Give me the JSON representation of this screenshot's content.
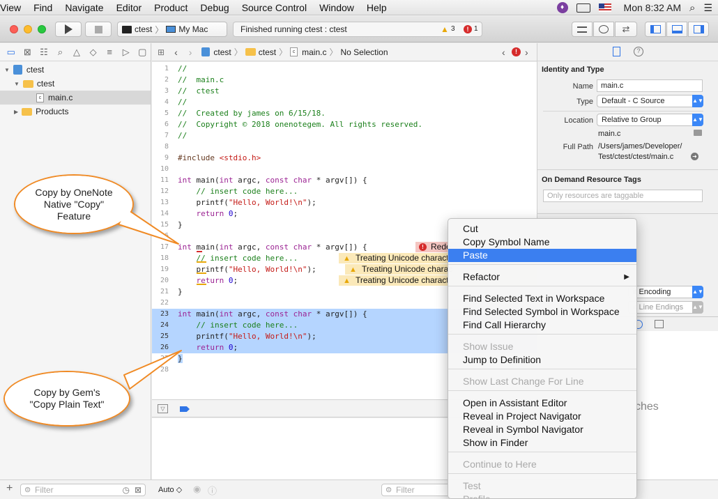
{
  "menubar": {
    "items": [
      "View",
      "Find",
      "Navigate",
      "Editor",
      "Product",
      "Debug",
      "Source Control",
      "Window",
      "Help"
    ],
    "clock": "Mon 8:32 AM"
  },
  "toolbar": {
    "scheme": "ctest",
    "destination": "My Mac",
    "status": "Finished running ctest : ctest",
    "warning_count": "3",
    "error_count": "1"
  },
  "navigator": {
    "items": [
      {
        "label": "ctest",
        "kind": "project"
      },
      {
        "label": "ctest",
        "kind": "folder"
      },
      {
        "label": "main.c",
        "kind": "file"
      },
      {
        "label": "Products",
        "kind": "folder"
      }
    ],
    "filter_placeholder": "Filter"
  },
  "jumpbar": {
    "crumbs": [
      "ctest",
      "ctest",
      "main.c",
      "No Selection"
    ]
  },
  "editor": {
    "lines": [
      {
        "n": "1",
        "t": "//",
        "c": "cm"
      },
      {
        "n": "2",
        "t": "//  main.c",
        "c": "cm"
      },
      {
        "n": "3",
        "t": "//  ctest",
        "c": "cm"
      },
      {
        "n": "4",
        "t": "//",
        "c": "cm"
      },
      {
        "n": "5",
        "t": "//  Created by james on 6/15/18.",
        "c": "cm"
      },
      {
        "n": "6",
        "t": "//  Copyright © 2018 onenotegem. All rights reserved.",
        "c": "cm"
      },
      {
        "n": "7",
        "t": "//",
        "c": "cm"
      },
      {
        "n": "8",
        "t": "",
        "c": ""
      },
      {
        "n": "9",
        "t": "#include <stdio.h>",
        "c": "pp"
      },
      {
        "n": "10",
        "t": "",
        "c": ""
      },
      {
        "n": "11",
        "t": "int main(int argc, const char * argv[]) {",
        "c": "fn"
      },
      {
        "n": "12",
        "t": "    // insert code here...",
        "c": "cm"
      },
      {
        "n": "13",
        "t": "    printf(\"Hello, World!\\n\");",
        "c": "pf"
      },
      {
        "n": "14",
        "t": "    return 0;",
        "c": "rt"
      },
      {
        "n": "15",
        "t": "}",
        "c": ""
      },
      {
        "n": "16",
        "t": "",
        "c": ""
      },
      {
        "n": "17",
        "t": "int main(int argc, const char * argv[]) {",
        "c": "fn"
      },
      {
        "n": "18",
        "t": "    // insert code here...",
        "c": "cm"
      },
      {
        "n": "19",
        "t": "    printf(\"Hello, World!\\n\");",
        "c": "pf"
      },
      {
        "n": "20",
        "t": "    return 0;",
        "c": "rt"
      },
      {
        "n": "21",
        "t": "}",
        "c": ""
      },
      {
        "n": "22",
        "t": "",
        "c": ""
      },
      {
        "n": "23",
        "t": "int main(int argc, const char * argv[]) {",
        "c": "fn"
      },
      {
        "n": "24",
        "t": "    // insert code here...",
        "c": "cm"
      },
      {
        "n": "25",
        "t": "    printf(\"Hello, World!\\n\");",
        "c": "pf"
      },
      {
        "n": "26",
        "t": "    return 0;",
        "c": "rt"
      },
      {
        "n": "27",
        "t": "}",
        "c": ""
      },
      {
        "n": "28",
        "t": "",
        "c": ""
      }
    ],
    "error_badge": "Rede",
    "warning_badge": "Treating Unicode charact",
    "warning_badge_19": "Treating Unicode charac"
  },
  "debug": {
    "auto_label": "Auto",
    "filter_placeholder": "Filter"
  },
  "inspector": {
    "identity_header": "Identity and Type",
    "name_label": "Name",
    "name_value": "main.c",
    "type_label": "Type",
    "type_value": "Default - C Source",
    "location_label": "Location",
    "location_value": "Relative to Group",
    "location_file": "main.c",
    "fullpath_label": "Full Path",
    "fullpath_value_1": "/Users/james/Developer/",
    "fullpath_value_2": "Test/ctest/ctest/main.c",
    "odr_header": "On Demand Resource Tags",
    "odr_placeholder": "Only resources are taggable",
    "text_encoding": "it Encoding",
    "line_endings": "it Line Endings",
    "matches_text": "ches"
  },
  "callouts": {
    "onenote": "Copy by OneNote Native \"Copy\" Feature",
    "gem": "Copy by Gem's \"Copy Plain Text\""
  },
  "context_menu": {
    "items": [
      {
        "label": "Cut",
        "state": "normal"
      },
      {
        "label": "Copy Symbol Name",
        "state": "normal"
      },
      {
        "label": "Paste",
        "state": "highlighted"
      },
      {
        "label": "Refactor",
        "state": "submenu"
      },
      {
        "label": "Find Selected Text in Workspace",
        "state": "normal"
      },
      {
        "label": "Find Selected Symbol in Workspace",
        "state": "normal"
      },
      {
        "label": "Find Call Hierarchy",
        "state": "normal"
      },
      {
        "label": "Show Issue",
        "state": "disabled"
      },
      {
        "label": "Jump to Definition",
        "state": "normal"
      },
      {
        "label": "Show Last Change For Line",
        "state": "disabled"
      },
      {
        "label": "Open in Assistant Editor",
        "state": "normal"
      },
      {
        "label": "Reveal in Project Navigator",
        "state": "normal"
      },
      {
        "label": "Reveal in Symbol Navigator",
        "state": "normal"
      },
      {
        "label": "Show in Finder",
        "state": "normal"
      },
      {
        "label": "Continue to Here",
        "state": "disabled"
      },
      {
        "label": "Test",
        "state": "disabled"
      },
      {
        "label": "Profile",
        "state": "disabled"
      }
    ]
  }
}
